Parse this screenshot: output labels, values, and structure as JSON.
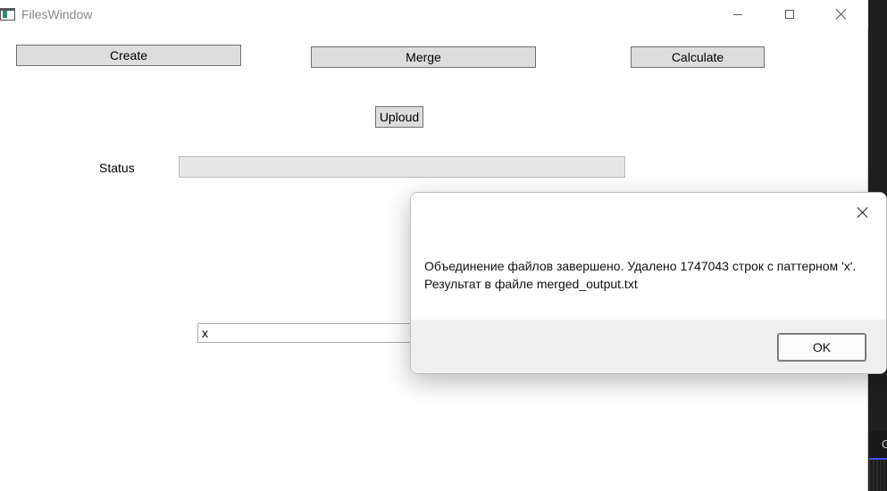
{
  "window": {
    "title": "FilesWindow"
  },
  "toolbar": {
    "create_label": "Create",
    "merge_label": "Merge",
    "calculate_label": "Calculate",
    "upload_label": "Uploud"
  },
  "status": {
    "label": "Status",
    "progress": 0
  },
  "pattern_input": {
    "value": "x"
  },
  "message_box": {
    "line1": "Объединение файлов завершено. Удалено 1747043 строк с паттерном 'x'.",
    "line2": "Результат в файле merged_output.txt",
    "ok_label": "OK"
  },
  "background": {
    "tab_glyph": "G"
  }
}
